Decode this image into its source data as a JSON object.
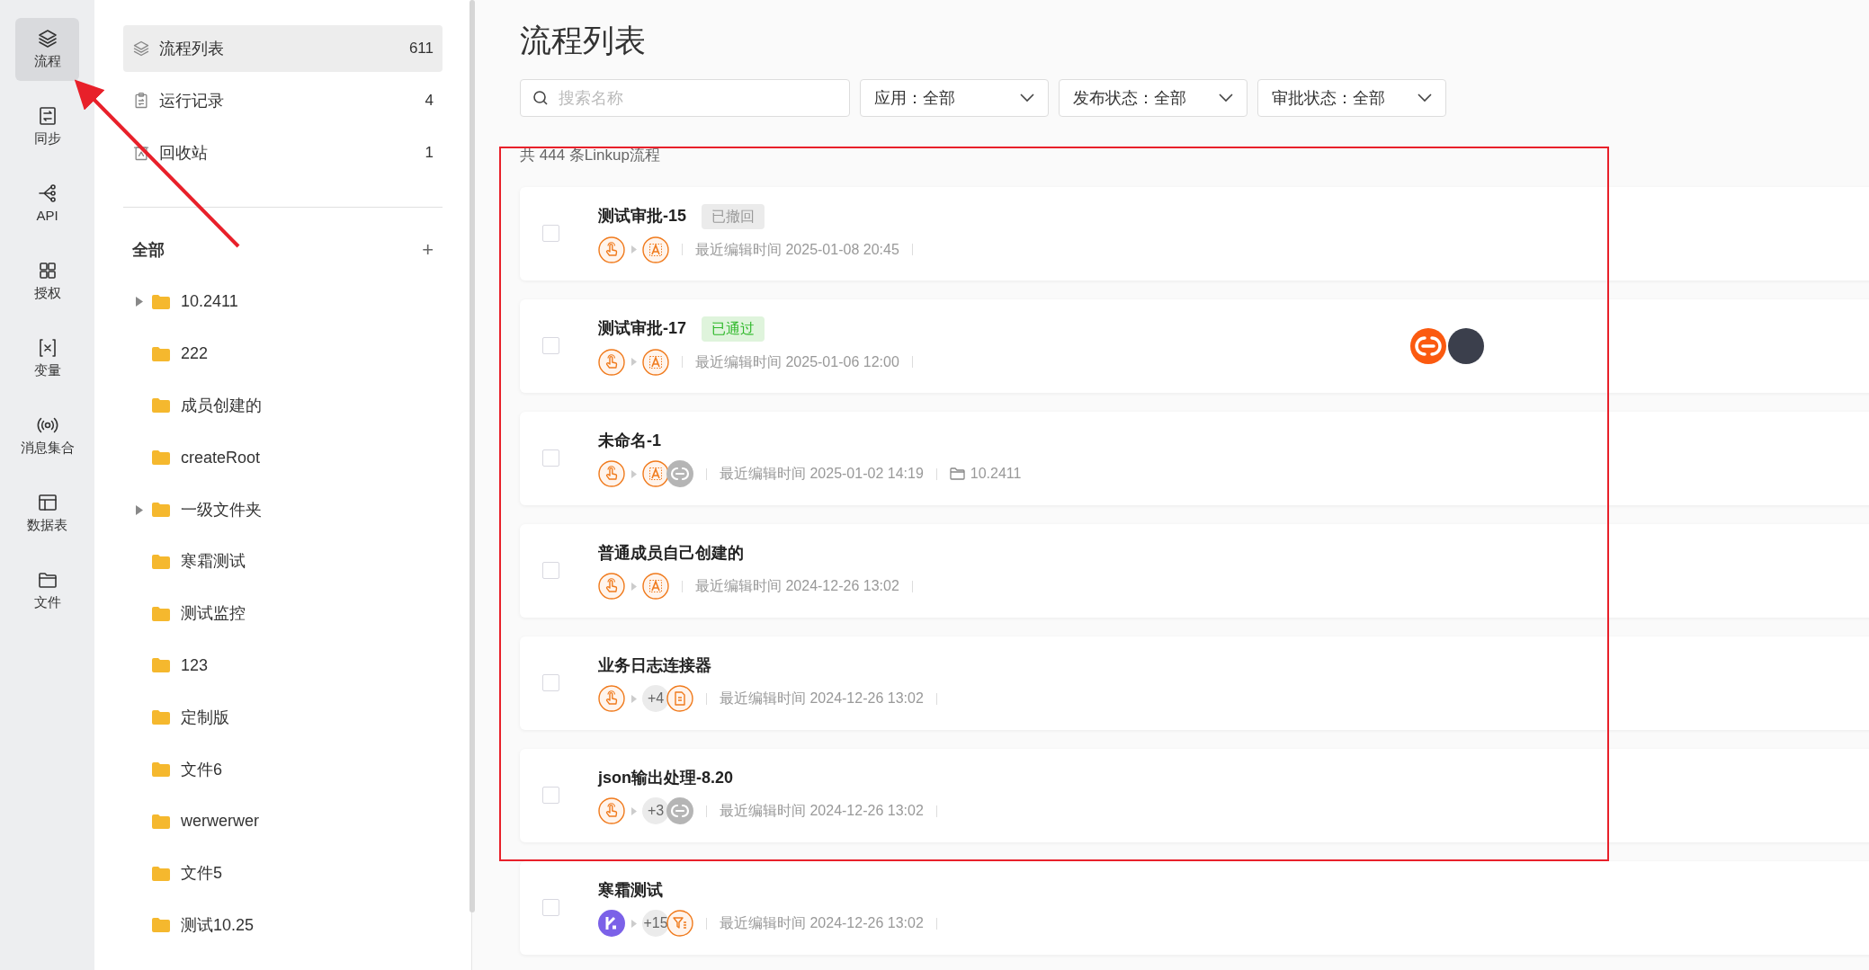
{
  "nav": [
    {
      "label": "流程",
      "selected": true
    },
    {
      "label": "同步",
      "selected": false
    },
    {
      "label": "API",
      "selected": false
    },
    {
      "label": "授权",
      "selected": false
    },
    {
      "label": "变量",
      "selected": false
    },
    {
      "label": "消息集合",
      "selected": false
    },
    {
      "label": "数据表",
      "selected": false
    },
    {
      "label": "文件",
      "selected": false
    }
  ],
  "sidebar": {
    "items": [
      {
        "label": "流程列表",
        "count": "611",
        "selected": true
      },
      {
        "label": "运行记录",
        "count": "4",
        "selected": false
      },
      {
        "label": "回收站",
        "count": "1",
        "selected": false
      }
    ],
    "folders_title": "全部",
    "add": "+",
    "folders": [
      {
        "label": "10.2411",
        "expandable": true
      },
      {
        "label": "222",
        "expandable": false
      },
      {
        "label": "成员创建的",
        "expandable": false
      },
      {
        "label": "createRoot",
        "expandable": false
      },
      {
        "label": "一级文件夹",
        "expandable": true
      },
      {
        "label": "寒霜测试",
        "expandable": false
      },
      {
        "label": "测试监控",
        "expandable": false
      },
      {
        "label": "123",
        "expandable": false
      },
      {
        "label": "定制版",
        "expandable": false
      },
      {
        "label": "文件6",
        "expandable": false
      },
      {
        "label": "werwerwer",
        "expandable": false
      },
      {
        "label": "文件5",
        "expandable": false
      },
      {
        "label": "测试10.25",
        "expandable": false
      }
    ]
  },
  "title": "流程列表",
  "search": {
    "placeholder": "搜索名称"
  },
  "filters": [
    {
      "label": "应用：全部"
    },
    {
      "label": "发布状态：全部"
    },
    {
      "label": "审批状态：全部"
    }
  ],
  "summary": "共 444 条Linkup流程",
  "flows": [
    {
      "name": "测试审批-15",
      "checked": false,
      "status": {
        "label": "已撤回",
        "kind": "revoked"
      },
      "steps": [
        {
          "kind": "trigger"
        },
        {
          "kind": "text-ai"
        }
      ],
      "edited": "最近编辑时间 2025-01-08 20:45"
    },
    {
      "name": "测试审批-17",
      "checked": false,
      "status": {
        "label": "已通过",
        "kind": "approved"
      },
      "steps": [
        {
          "kind": "trigger"
        },
        {
          "kind": "text-ai"
        }
      ],
      "edited": "最近编辑时间 2025-01-06 12:00",
      "owners": [
        {
          "kind": "connector"
        },
        {
          "kind": "photo"
        }
      ]
    },
    {
      "name": "未命名-1",
      "checked": false,
      "steps": [
        {
          "kind": "trigger"
        },
        {
          "kind": "text-ai"
        },
        {
          "kind": "link"
        }
      ],
      "edited": "最近编辑时间 2025-01-02 14:19",
      "folder": "10.2411"
    },
    {
      "name": "普通成员自己创建的",
      "checked": false,
      "steps": [
        {
          "kind": "trigger"
        },
        {
          "kind": "text-ai"
        }
      ],
      "edited": "最近编辑时间 2024-12-26 13:02"
    },
    {
      "name": "业务日志连接器",
      "checked": false,
      "steps": [
        {
          "kind": "trigger"
        },
        {
          "kind": "count",
          "label": "+4"
        },
        {
          "kind": "document"
        }
      ],
      "edited": "最近编辑时间 2024-12-26 13:02"
    },
    {
      "name": "json输出处理-8.20",
      "checked": false,
      "steps": [
        {
          "kind": "trigger"
        },
        {
          "kind": "count",
          "label": "+3"
        },
        {
          "kind": "link"
        }
      ],
      "edited": "最近编辑时间 2024-12-26 13:02"
    },
    {
      "name": "寒霜测试",
      "checked": false,
      "steps": [
        {
          "kind": "app"
        },
        {
          "kind": "count",
          "label": "+15"
        },
        {
          "kind": "filter"
        }
      ],
      "edited": "最近编辑时间 2024-12-26 13:02"
    }
  ]
}
